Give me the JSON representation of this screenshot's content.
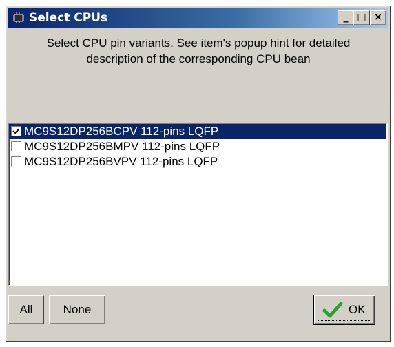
{
  "window": {
    "title": "Select CPUs",
    "min_glyph": "_",
    "max_glyph": "□",
    "close_glyph": "×"
  },
  "description": {
    "line1": "Select CPU pin variants. See item's popup hint for detailed",
    "line2": "description of the corresponding CPU bean"
  },
  "list": {
    "items": [
      {
        "label": "MC9S12DP256BCPV 112-pins LQFP",
        "checked": true,
        "selected": true
      },
      {
        "label": "MC9S12DP256BMPV 112-pins LQFP",
        "checked": false,
        "selected": false
      },
      {
        "label": "MC9S12DP256BVPV 112-pins LQFP",
        "checked": false,
        "selected": false
      }
    ]
  },
  "buttons": {
    "all": "All",
    "none": "None",
    "ok": "OK"
  },
  "colors": {
    "selection": "#0a246a",
    "ok_check": "#2ea02e"
  }
}
